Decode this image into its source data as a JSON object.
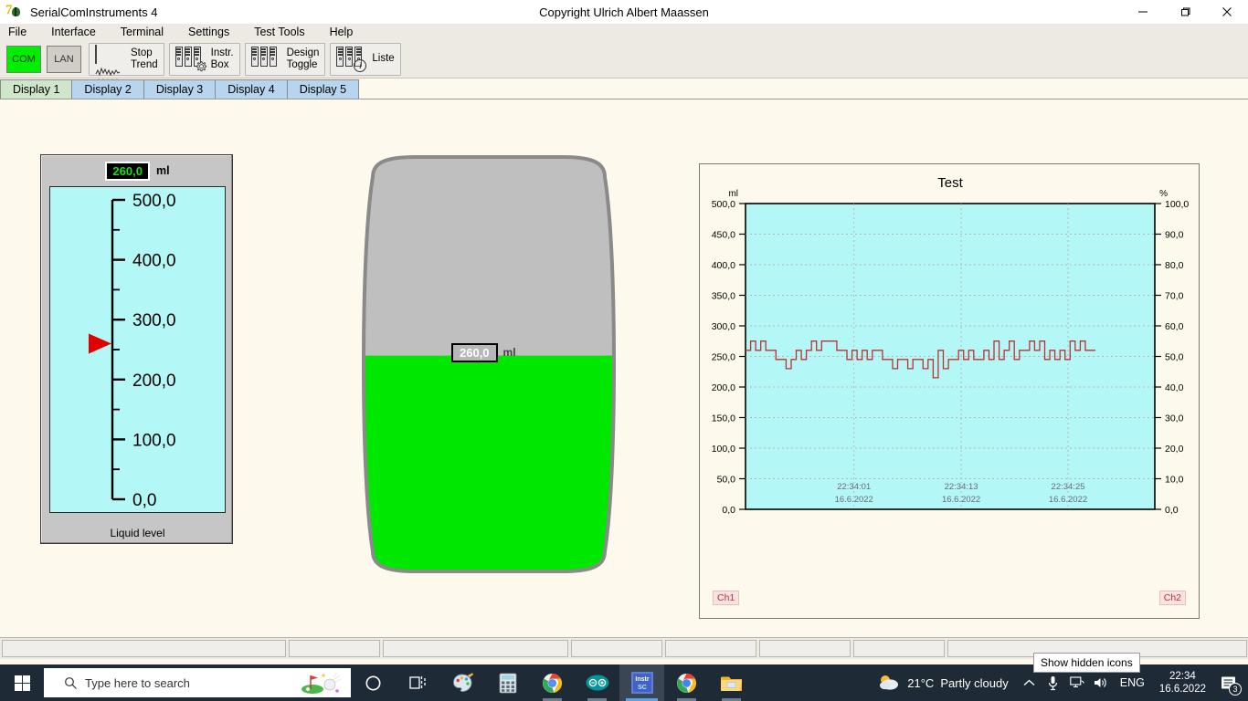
{
  "window": {
    "title": "SerialComInstruments  4",
    "copyright": "Copyright Ulrich Albert Maassen",
    "minimize": "–",
    "maximize": "❐",
    "close": "✕"
  },
  "menu": [
    {
      "label": "File"
    },
    {
      "label": "Interface"
    },
    {
      "label": "Terminal"
    },
    {
      "label": "Settings"
    },
    {
      "label": "Test Tools"
    },
    {
      "label": "Help"
    }
  ],
  "toolbar": {
    "com": "COM",
    "lan": "LAN",
    "com_color": "#00ef00",
    "buttons": [
      {
        "label": "Stop\nTrend",
        "icon": "trend-icon"
      },
      {
        "label": "Instr.\nBox",
        "icon": "instrument-box-icon"
      },
      {
        "label": "Design\nToggle",
        "icon": "design-toggle-icon"
      },
      {
        "label": "Liste",
        "icon": "list-icon"
      }
    ]
  },
  "tabs": [
    {
      "label": "Display 1",
      "active": true
    },
    {
      "label": "Display 2",
      "active": false
    },
    {
      "label": "Display 3",
      "active": false
    },
    {
      "label": "Display 4",
      "active": false
    },
    {
      "label": "Display 5",
      "active": false
    }
  ],
  "gauge": {
    "value": "260,0",
    "unit": "ml",
    "caption": "Liquid level",
    "scale_labels": [
      "500,0",
      "400,0",
      "300,0",
      "200,0",
      "100,0",
      "0,0"
    ],
    "min": 0,
    "max": 500,
    "pointer_value": 260,
    "face_color": "#b4f7f7",
    "pointer_color": "#e00000"
  },
  "tank": {
    "value": "260,0",
    "unit": "ml",
    "fill_percent": 52,
    "fill_color": "#00e800",
    "empty_color": "#bfbfbf"
  },
  "chart_data": {
    "type": "line",
    "title": "Test",
    "ylabel": "ml",
    "y2label": "%",
    "ylim": [
      0,
      500
    ],
    "y2lim": [
      0,
      100
    ],
    "yticks": [
      "0,0",
      "50,0",
      "100,0",
      "150,0",
      "200,0",
      "250,0",
      "300,0",
      "350,0",
      "400,0",
      "450,0",
      "500,0"
    ],
    "y2ticks": [
      "0,0",
      "10,0",
      "20,0",
      "30,0",
      "40,0",
      "50,0",
      "60,0",
      "70,0",
      "80,0",
      "90,0",
      "100,0"
    ],
    "grid": true,
    "legend_left": "Ch1",
    "legend_right": "Ch2",
    "plot_bg": "#b4f7f7",
    "line_color": "#c03030",
    "x_tick_labels": [
      {
        "time": "22:34:01",
        "date": "16.6.2022",
        "pos": 0.265
      },
      {
        "time": "22:34:13",
        "date": "16.6.2022",
        "pos": 0.527
      },
      {
        "time": "22:34:25",
        "date": "16.6.2022",
        "pos": 0.788
      }
    ],
    "series": [
      {
        "name": "Ch1",
        "unit": "ml",
        "step": true,
        "values": [
          260,
          275,
          260,
          275,
          260,
          260,
          245,
          245,
          230,
          245,
          260,
          245,
          260,
          275,
          260,
          275,
          275,
          275,
          260,
          260,
          245,
          260,
          245,
          260,
          245,
          260,
          260,
          245,
          245,
          230,
          245,
          245,
          230,
          245,
          245,
          230,
          245,
          215,
          260,
          230,
          245,
          245,
          260,
          245,
          260,
          245,
          245,
          260,
          245,
          275,
          245,
          260,
          275,
          245,
          260,
          260,
          275,
          260,
          275,
          245,
          260,
          245,
          260,
          245,
          275,
          260,
          275,
          260,
          260
        ]
      }
    ]
  },
  "statusbar": {
    "cells": [
      "",
      "",
      "",
      "",
      "",
      "",
      "",
      ""
    ]
  },
  "taskbar": {
    "start": "start-button",
    "search_placeholder": "Type here to search",
    "apps": [
      {
        "name": "cortana-icon"
      },
      {
        "name": "task-view-icon"
      },
      {
        "name": "paint-icon"
      },
      {
        "name": "calculator-icon"
      },
      {
        "name": "chrome-icon"
      },
      {
        "name": "arduino-icon"
      },
      {
        "name": "instrsc-icon",
        "label": "Instr\nSC",
        "active": true
      },
      {
        "name": "chrome-icon-2"
      },
      {
        "name": "file-explorer-icon"
      }
    ],
    "weather_temp": "21°C",
    "weather_desc": "Partly cloudy",
    "language": "ENG",
    "time": "22:34",
    "date": "16.6.2022",
    "notification_count": "3",
    "tooltip": "Show hidden icons"
  }
}
